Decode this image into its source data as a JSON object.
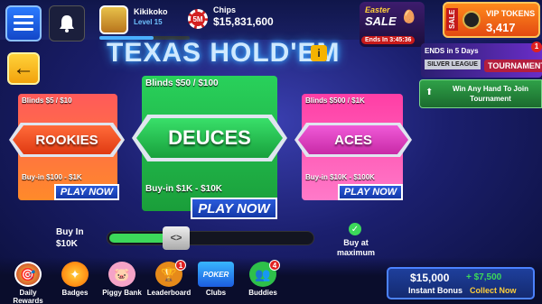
{
  "topbar": {
    "username": "Kikikoko",
    "level": "Level 15",
    "level_progress": 0.6,
    "chips_label": "Chips",
    "chips_value": "$15,831,600",
    "chip_badge": "5M"
  },
  "sale": {
    "line1": "Easter",
    "line2": "SALE",
    "timer": "Ends In 3:45:36"
  },
  "vip": {
    "label": "VIP TOKENS",
    "value": "3,417"
  },
  "title": "TEXAS HOLD'EM",
  "tournament": {
    "ends": "ENDS in 5 Days",
    "league": "SILVER LEAGUE",
    "name": "TOURNAMENT",
    "join": "Win Any Hand To Join Tournament",
    "badge": "1"
  },
  "tables": [
    {
      "name": "ROOKIES",
      "blinds": "Blinds $5 / $10",
      "buyin": "Buy-in $100 - $1K",
      "play": "PLAY NOW"
    },
    {
      "name": "DEUCES",
      "blinds": "Blinds $50 / $100",
      "buyin": "Buy-in $1K - $10K",
      "play": "PLAY NOW"
    },
    {
      "name": "ACES",
      "blinds": "Blinds $500 / $1K",
      "buyin": "Buy-in $10K - $100K",
      "play": "PLAY NOW"
    }
  ],
  "buyin": {
    "label": "Buy In",
    "value": "$10K",
    "max_label": "Buy at maximum",
    "slider_fraction": 0.3,
    "knob_glyph": "<>"
  },
  "nav": [
    {
      "label": "Daily Rewards",
      "icon": "target-icon",
      "badge": ""
    },
    {
      "label": "Badges",
      "icon": "badge-icon",
      "badge": ""
    },
    {
      "label": "Piggy Bank",
      "icon": "piggy-bank-icon",
      "badge": ""
    },
    {
      "label": "Leaderboard",
      "icon": "trophy-icon",
      "badge": "1"
    },
    {
      "label": "Clubs",
      "icon": "poker-clubs-icon",
      "badge": ""
    },
    {
      "label": "Buddies",
      "icon": "buddies-icon",
      "badge": "4"
    }
  ],
  "bonus": {
    "amount": "$15,000",
    "extra": "+ $7,500",
    "text": "Instant Bonus",
    "cta": "Collect Now"
  },
  "colors": {
    "accent": "#2a5bdb",
    "rookies": "#ff5a5a",
    "deuces": "#29d15b",
    "aces": "#ff3ea5",
    "vip": "#ff8a1c"
  }
}
